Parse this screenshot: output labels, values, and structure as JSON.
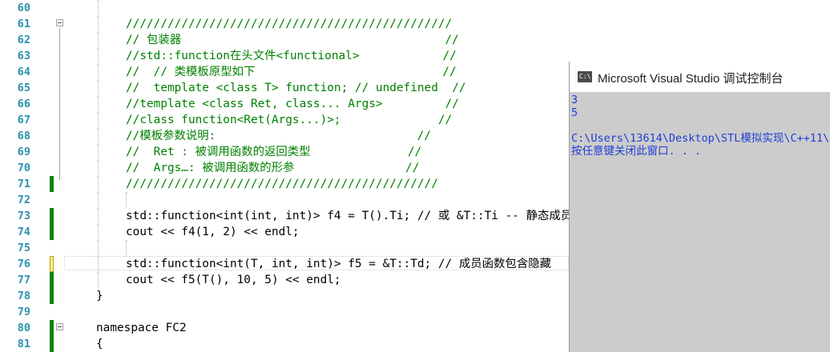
{
  "editor": {
    "lines": [
      {
        "num": "60",
        "text": ""
      },
      {
        "num": "61",
        "text": "///////////////////////////////////////////////"
      },
      {
        "num": "62",
        "text": "// 包装器                                      //"
      },
      {
        "num": "63",
        "text": "//std::function在头文件<functional>            //"
      },
      {
        "num": "64",
        "text": "//  // 类模板原型如下                           //"
      },
      {
        "num": "65",
        "text": "//  template <class T> function; // undefined  //"
      },
      {
        "num": "66",
        "text": "//template <class Ret, class... Args>         //"
      },
      {
        "num": "67",
        "text": "//class function<Ret(Args...)>;              //"
      },
      {
        "num": "68",
        "text": "//模板参数说明:                             //"
      },
      {
        "num": "69",
        "text": "//  Ret : 被调用函数的返回类型              //"
      },
      {
        "num": "70",
        "text": "//  Args…: 被调用函数的形参                //"
      },
      {
        "num": "71",
        "text": "/////////////////////////////////////////////"
      },
      {
        "num": "72",
        "text": ""
      },
      {
        "num": "73",
        "text": "std::function<int(int, int)> f4 = T().Ti; // 或 &T::Ti -- 静态成员"
      },
      {
        "num": "74",
        "text": "cout << f4(1, 2) << endl;"
      },
      {
        "num": "75",
        "text": ""
      },
      {
        "num": "76",
        "text": "std::function<int(T, int, int)> f5 = &T::Td; // 成员函数包含隐藏"
      },
      {
        "num": "77",
        "text": "cout << f5(T(), 10, 5) << endl;"
      },
      {
        "num": "78",
        "text": "}"
      },
      {
        "num": "79",
        "text": ""
      },
      {
        "num": "80",
        "text": "namespace FC2"
      },
      {
        "num": "81",
        "text": "{"
      }
    ]
  },
  "console": {
    "title": "Microsoft Visual Studio 调试控制台",
    "icon": "console-app-icon",
    "icon_glyph": "C:\\",
    "output": [
      "3",
      "5",
      "",
      "C:\\Users\\13614\\Desktop\\STL模拟实现\\C++11\\",
      "按任意键关闭此窗口. . ."
    ]
  },
  "colors": {
    "line_number": "#2b91af",
    "comment": "#008000",
    "keyword": "#0000ff",
    "type": "#2b91af",
    "change_saved": "#108010",
    "console_bg": "#cccccc",
    "console_text": "#1e3dd6"
  }
}
